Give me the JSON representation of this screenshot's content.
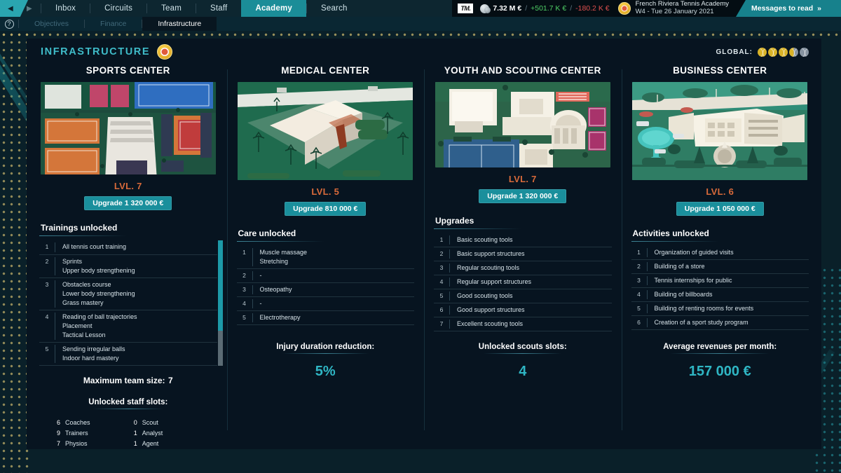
{
  "topnav": {
    "back_icon": "chevron-left-icon",
    "forward_icon": "chevron-right-icon",
    "items": [
      {
        "label": "Inbox",
        "active": false
      },
      {
        "label": "Circuits",
        "active": false
      },
      {
        "label": "Team",
        "active": false
      },
      {
        "label": "Staff",
        "active": false
      },
      {
        "label": "Academy",
        "active": true
      },
      {
        "label": "Search",
        "active": false
      }
    ],
    "brand": "TM.",
    "money": "7.32 M €",
    "income": "+501.7 K €",
    "separator": "/",
    "expenses": "-180.2 K €",
    "academy_name": "French Riviera Tennis Academy",
    "academy_date": "W4 - Tue 26 January 2021",
    "messages_label": "Messages to read",
    "messages_icon": "double-chevron-right-icon"
  },
  "subnav": {
    "help_icon": "question-mark-icon",
    "help_glyph": "?",
    "items": [
      {
        "label": "Objectives",
        "active": false
      },
      {
        "label": "Finance",
        "active": false
      },
      {
        "label": "Infrastructure",
        "active": true
      }
    ]
  },
  "page": {
    "title": "INFRASTRUCTURE",
    "badge_icon": "academy-crest-icon",
    "global_label": "GLOBAL:",
    "global_rating": {
      "total": 5,
      "full": 3,
      "half": 1,
      "empty": 1
    }
  },
  "colors": {
    "accent_teal": "#2fb6c4",
    "button_teal": "#1a8f9c",
    "level_orange": "#d86a3a",
    "panel_bg": "#071420",
    "nav_active": "#1b8d98",
    "income_green": "#4fcf66",
    "expense_red": "#e0504f",
    "ball_gold": "#d9b328",
    "ball_grey": "#8693a0"
  },
  "columns": [
    {
      "title": "SPORTS CENTER",
      "thumb_name": "sports-center-thumbnail",
      "level": "LVL. 7",
      "upgrade_label": "Upgrade 1 320 000 €",
      "section_head": "Trainings unlocked",
      "scrollbar": {
        "thumb_pct": 72
      },
      "list": [
        {
          "num": "1",
          "lines": [
            "All tennis court training"
          ]
        },
        {
          "num": "2",
          "lines": [
            "Sprints",
            "Upper body strengthening"
          ]
        },
        {
          "num": "3",
          "lines": [
            "Obstacles course",
            "Lower body strengthening",
            "Grass mastery"
          ]
        },
        {
          "num": "4",
          "lines": [
            "Reading of ball trajectories",
            "Placement",
            "Tactical Lesson"
          ]
        },
        {
          "num": "5",
          "lines": [
            "Sending irregular balls",
            "Indoor hard mastery"
          ]
        }
      ],
      "inline_stat": {
        "label": "Maximum team size:",
        "value": "7"
      },
      "staff_label": "Unlocked staff slots:",
      "staff": [
        {
          "n": "6",
          "role": "Coaches"
        },
        {
          "n": "0",
          "role": "Scout"
        },
        {
          "n": "9",
          "role": "Trainers"
        },
        {
          "n": "1",
          "role": "Analyst"
        },
        {
          "n": "7",
          "role": "Physios"
        },
        {
          "n": "1",
          "role": "Agent"
        }
      ]
    },
    {
      "title": "MEDICAL CENTER",
      "thumb_name": "medical-center-thumbnail",
      "level": "LVL. 5",
      "upgrade_label": "Upgrade 810 000 €",
      "section_head": "Care unlocked",
      "list": [
        {
          "num": "1",
          "lines": [
            "Muscle massage",
            "Stretching"
          ]
        },
        {
          "num": "2",
          "lines": [
            "-"
          ]
        },
        {
          "num": "3",
          "lines": [
            "Osteopathy"
          ]
        },
        {
          "num": "4",
          "lines": [
            "-"
          ]
        },
        {
          "num": "5",
          "lines": [
            "Electrotherapy"
          ]
        }
      ],
      "stat_label": "Injury duration reduction:",
      "stat_value": "5%"
    },
    {
      "title": "YOUTH AND SCOUTING CENTER",
      "thumb_name": "youth-scouting-center-thumbnail",
      "level": "LVL. 7",
      "upgrade_label": "Upgrade 1 320 000 €",
      "section_head": "Upgrades",
      "list": [
        {
          "num": "1",
          "lines": [
            "Basic scouting tools"
          ]
        },
        {
          "num": "2",
          "lines": [
            "Basic support structures"
          ]
        },
        {
          "num": "3",
          "lines": [
            "Regular scouting tools"
          ]
        },
        {
          "num": "4",
          "lines": [
            "Regular support structures"
          ]
        },
        {
          "num": "5",
          "lines": [
            "Good scouting tools"
          ]
        },
        {
          "num": "6",
          "lines": [
            "Good support structures"
          ]
        },
        {
          "num": "7",
          "lines": [
            "Excellent scouting tools"
          ]
        }
      ],
      "stat_label": "Unlocked scouts slots:",
      "stat_value": "4"
    },
    {
      "title": "BUSINESS CENTER",
      "thumb_name": "business-center-thumbnail",
      "level": "LVL. 6",
      "upgrade_label": "Upgrade 1 050 000 €",
      "section_head": "Activities unlocked",
      "list": [
        {
          "num": "1",
          "lines": [
            "Organization of guided visits"
          ]
        },
        {
          "num": "2",
          "lines": [
            "Building of a store"
          ]
        },
        {
          "num": "3",
          "lines": [
            "Tennis internships for public"
          ]
        },
        {
          "num": "4",
          "lines": [
            "Building of billboards"
          ]
        },
        {
          "num": "5",
          "lines": [
            "Building of renting rooms for events"
          ]
        },
        {
          "num": "6",
          "lines": [
            "Creation of a sport study program"
          ]
        }
      ],
      "stat_label": "Average revenues per month:",
      "stat_value": "157 000 €"
    }
  ]
}
